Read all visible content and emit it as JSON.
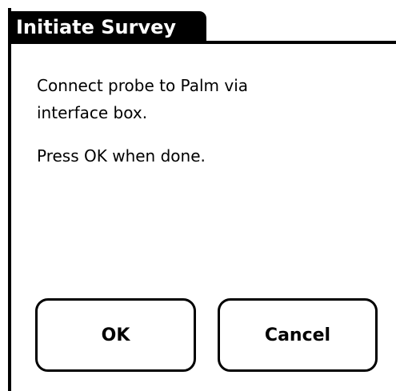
{
  "dialog": {
    "title": "Initiate Survey",
    "message_lines": [
      "Connect probe to Palm via",
      "interface box.",
      "Press OK when done."
    ],
    "buttons": {
      "ok_label": "OK",
      "cancel_label": "Cancel"
    }
  },
  "colors": {
    "background": "#ffffff",
    "foreground": "#000000"
  }
}
